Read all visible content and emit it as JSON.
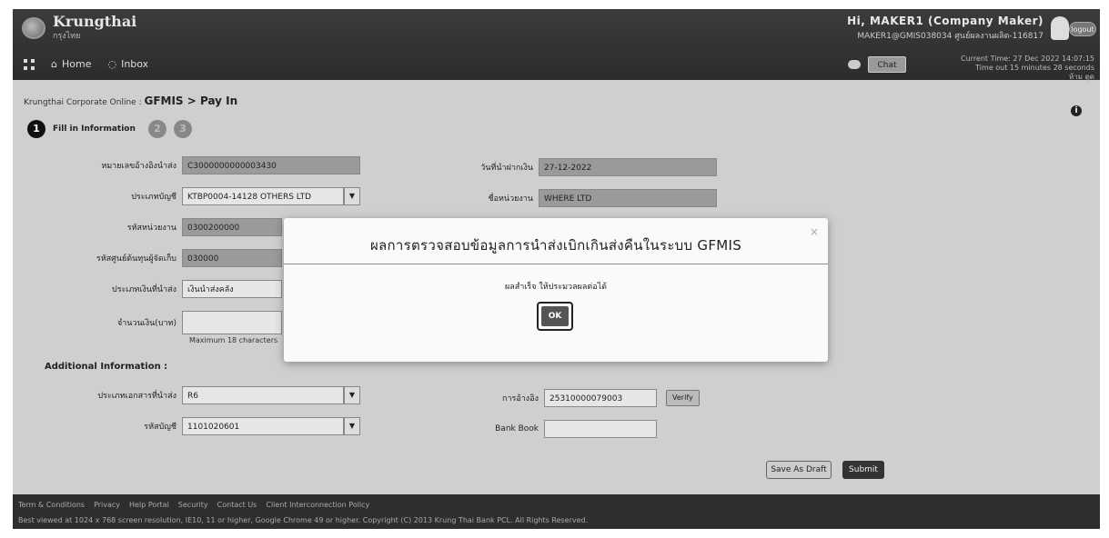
{
  "header": {
    "brand": "Krungthai",
    "brand_sub": "กรุงไทย",
    "nav": {
      "home": "Home",
      "inbox": "Inbox"
    },
    "user": {
      "greeting": "Hi, MAKER1 (Company Maker)",
      "sub": "MAKER1@GMIS038034  ศูนย์ผลงานผลิต-116817"
    },
    "logout_label": "logout",
    "chat_label": "Chat",
    "session": [
      "Current Time: 27 Dec 2022 14:07:15",
      "Time out 15 minutes 28 seconds",
      "ห้าม ดูด"
    ]
  },
  "breadcrumb": {
    "prefix": "Krungthai Corporate Online : ",
    "current": "GFMIS > Pay In"
  },
  "steps": [
    {
      "number": "1",
      "label": "Fill in Information"
    },
    {
      "number": "2",
      "label": ""
    },
    {
      "number": "3",
      "label": ""
    }
  ],
  "form": {
    "left": [
      {
        "label": "หมายเลขอ้างอิงนำส่ง",
        "value": "C3000000000003430"
      },
      {
        "label": "ประเภทบัญชี",
        "value": "KTBP0004-14128 OTHERS LTD"
      },
      {
        "label": "รหัสหน่วยงาน",
        "value": "0300200000"
      },
      {
        "label": "รหัสศูนย์ต้นทุนผู้จัดเก็บ",
        "value": "030000"
      },
      {
        "label": "ประเภทเงินที่นำส่ง",
        "value": "เงินนำส่งคลัง"
      },
      {
        "label": "จำนวนเงิน(บาท)",
        "value": ""
      }
    ],
    "right": [
      {
        "label": "วันที่นำฝากเงิน",
        "value": "27-12-2022"
      },
      {
        "label": "ชื่อหน่วยงาน",
        "value": "WHERE LTD"
      }
    ],
    "amount_hint": "Maximum 18 characters"
  },
  "additional": {
    "title": "Additional Information :",
    "rows": [
      {
        "label": "ประเภทเอกสารที่นำส่ง",
        "value": "R6"
      },
      {
        "label": "รหัสบัญชี",
        "value": "1101020601"
      }
    ],
    "right_rows": [
      {
        "label": "การอ้างอิง",
        "value": "25310000079003",
        "button": "Verify"
      },
      {
        "label": "Bank Book",
        "value": ""
      }
    ]
  },
  "actions": {
    "save_draft": "Save As Draft",
    "submit": "Submit"
  },
  "footer": {
    "links": [
      "Term & Conditions",
      "Privacy",
      "Help Portal",
      "Security",
      "Contact Us",
      "Client Interconnection Policy"
    ],
    "copyright": "Best viewed at 1024 x 768 screen resolution, IE10, 11 or higher, Google Chrome 49 or higher. Copyright (C) 2013 Krung Thai Bank PCL. All Rights Reserved."
  },
  "modal": {
    "title": "ผลการตรวจสอบข้อมูลการนำส่งเบิกเกินส่งคืนในระบบ GFMIS",
    "close": "×",
    "message": "ผลสำเร็จ ให้ประมวลผลต่อได้",
    "ok_label": "OK"
  }
}
